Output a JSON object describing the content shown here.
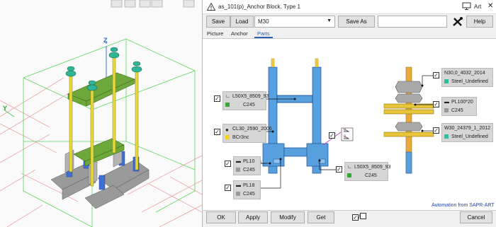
{
  "viewport": {
    "axis_z": "Z",
    "axis_y": "Y"
  },
  "window": {
    "title": "as_101(p)_Anchor Block. Type 1",
    "art_label": "Art",
    "close": "✕"
  },
  "toolbar": {
    "save": "Save",
    "load": "Load",
    "preset": "M30",
    "save_as": "Save As",
    "help": "Help"
  },
  "tabs": [
    "Picture",
    "Anchor",
    "Parts"
  ],
  "parts": {
    "angle_top": {
      "profile": "L50X5_8509_93",
      "material": "C245",
      "color": "#3aa63a"
    },
    "bolt": {
      "profile": "CL30_2590_2006",
      "material": "BCr3nc",
      "color": "#f2d21b"
    },
    "plate10": {
      "profile": "PL10",
      "material": "C245",
      "color": "#9a9a9a"
    },
    "plate18": {
      "profile": "PL18",
      "material": "C245",
      "color": "#9a9a9a"
    },
    "angle_bottom": {
      "profile": "L50X5_8509_93",
      "material": "C245",
      "color": "#3aa63a"
    },
    "nut": {
      "profile": "N30,0_4032_2014",
      "material": "Steel_Undefined",
      "color": "#2fbfa0"
    },
    "washer_plate": {
      "profile": "PL100*20",
      "material": "C245",
      "color": "#9a9a9a"
    },
    "washer": {
      "profile": "W30_24379_1_2012",
      "material": "Steel_Undefined",
      "color": "#2fbfa0"
    },
    "weld_label_top": "8",
    "weld_label_bottom": "8"
  },
  "footer": {
    "link": "Automation from SAPR-ART",
    "ok": "OK",
    "apply": "Apply",
    "modify": "Modify",
    "get": "Get",
    "toggle_sep": "/",
    "cancel": "Cancel"
  }
}
